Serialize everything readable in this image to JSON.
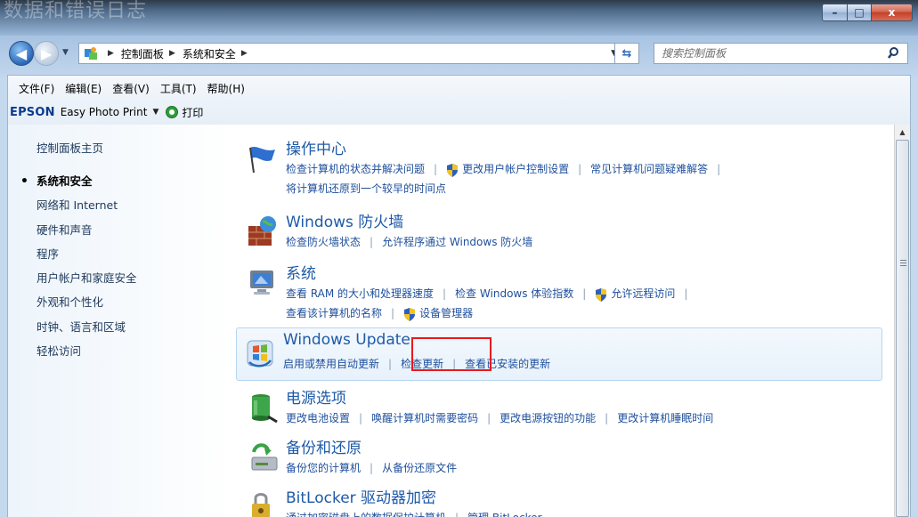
{
  "window": {
    "ghost_title": "数据和错误日志",
    "controls": {
      "minimize": "–",
      "maximize": "□",
      "close": "x"
    }
  },
  "nav": {
    "back_glyph": "◀",
    "fwd_glyph": "▶",
    "breadcrumb": [
      "控制面板",
      "系统和安全"
    ],
    "crumb_sep": "▶",
    "search_placeholder": "搜索控制面板"
  },
  "menu": [
    "文件(F)",
    "编辑(E)",
    "查看(V)",
    "工具(T)",
    "帮助(H)"
  ],
  "toolbar": {
    "brand": "EPSON",
    "app": "Easy Photo Print",
    "print": "打印"
  },
  "sidebar": {
    "home": "控制面板主页",
    "items": [
      {
        "label": "系统和安全",
        "active": true
      },
      {
        "label": "网络和 Internet",
        "active": false
      },
      {
        "label": "硬件和声音",
        "active": false
      },
      {
        "label": "程序",
        "active": false
      },
      {
        "label": "用户帐户和家庭安全",
        "active": false
      },
      {
        "label": "外观和个性化",
        "active": false
      },
      {
        "label": "时钟、语言和区域",
        "active": false
      },
      {
        "label": "轻松访问",
        "active": false
      }
    ]
  },
  "sections": {
    "action_center": {
      "title": "操作中心",
      "links": [
        "检查计算机的状态并解决问题",
        "更改用户帐户控制设置",
        "常见计算机问题疑难解答",
        "将计算机还原到一个较早的时间点"
      ]
    },
    "firewall": {
      "title": "Windows 防火墙",
      "links": [
        "检查防火墙状态",
        "允许程序通过 Windows 防火墙"
      ]
    },
    "system": {
      "title": "系统",
      "links": [
        "查看 RAM 的大小和处理器速度",
        "检查 Windows 体验指数",
        "允许远程访问",
        "查看该计算机的名称",
        "设备管理器"
      ]
    },
    "windows_update": {
      "title": "Windows Update",
      "links": [
        "启用或禁用自动更新",
        "检查更新",
        "查看已安装的更新"
      ]
    },
    "power": {
      "title": "电源选项",
      "links": [
        "更改电池设置",
        "唤醒计算机时需要密码",
        "更改电源按钮的功能",
        "更改计算机睡眠时间"
      ]
    },
    "backup": {
      "title": "备份和还原",
      "links": [
        "备份您的计算机",
        "从备份还原文件"
      ]
    },
    "bitlocker": {
      "title": "BitLocker 驱动器加密",
      "links": [
        "通过加密磁盘上的数据保护计算机",
        "管理 BitLocker"
      ]
    }
  },
  "colors": {
    "link": "#1e4f9c",
    "title": "#1e5aa8",
    "highlight_box": "#e8191f"
  }
}
